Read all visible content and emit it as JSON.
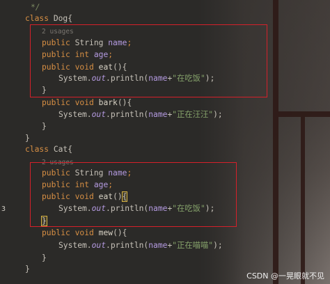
{
  "editor": {
    "lines": [
      {
        "kind": "comment",
        "text": "*/"
      },
      {
        "kind": "class",
        "keyword": "class",
        "name": "Dog",
        "brace": "{"
      },
      {
        "kind": "usages",
        "text": "2 usages"
      },
      {
        "kind": "field",
        "mod": "public",
        "type": "String",
        "name": "name",
        "end": ";"
      },
      {
        "kind": "field",
        "mod": "public",
        "type": "int",
        "name": "age",
        "end": ";"
      },
      {
        "kind": "method",
        "mod": "public",
        "ret": "void",
        "name": "eat",
        "sig": "(){"
      },
      {
        "kind": "print",
        "prefix": "System.",
        "out": "out",
        "call": ".println(",
        "arg": "name",
        "plus": "+",
        "str": "\"在吃饭\"",
        "end": ");"
      },
      {
        "kind": "close",
        "text": "}"
      },
      {
        "kind": "method",
        "mod": "public",
        "ret": "void",
        "name": "bark",
        "sig": "(){"
      },
      {
        "kind": "print",
        "prefix": "System.",
        "out": "out",
        "call": ".println(",
        "arg": "name",
        "plus": "+",
        "str": "\"正在汪汪\"",
        "end": ");"
      },
      {
        "kind": "close",
        "text": "}"
      },
      {
        "kind": "close",
        "text": "}"
      },
      {
        "kind": "class",
        "keyword": "class",
        "name": "Cat",
        "brace": "{"
      },
      {
        "kind": "usages",
        "text": "2 usages"
      },
      {
        "kind": "field",
        "mod": "public",
        "type": "String",
        "name": "name",
        "end": ";"
      },
      {
        "kind": "field",
        "mod": "public",
        "type": "int",
        "name": "age",
        "end": ";"
      },
      {
        "kind": "method",
        "mod": "public",
        "ret": "void",
        "name": "eat",
        "sig": "(){"
      },
      {
        "kind": "print",
        "prefix": "System.",
        "out": "out",
        "call": ".println(",
        "arg": "name",
        "plus": "+",
        "str": "\"在吃饭\"",
        "end": ");"
      },
      {
        "kind": "close",
        "text": "}"
      },
      {
        "kind": "method",
        "mod": "public",
        "ret": "void",
        "name": "mew",
        "sig": "(){"
      },
      {
        "kind": "print",
        "prefix": "System.",
        "out": "out",
        "call": ".println(",
        "arg": "name",
        "plus": "+",
        "str": "\"正在喵喵\"",
        "end": ");"
      },
      {
        "kind": "close",
        "text": "}"
      },
      {
        "kind": "close",
        "text": "}"
      }
    ],
    "gutter_numbers": [
      "",
      "",
      "",
      "",
      "",
      "",
      "",
      "",
      "",
      "",
      "",
      "",
      "",
      "",
      "",
      "",
      "",
      "3",
      "",
      "",
      "",
      "",
      ""
    ]
  },
  "watermark": "CSDN @一晃眼就不见",
  "colors": {
    "keyword": "#d78f44",
    "identifier": "#b49ae0",
    "string": "#86a36b",
    "highlight_box": "#d6202a"
  }
}
